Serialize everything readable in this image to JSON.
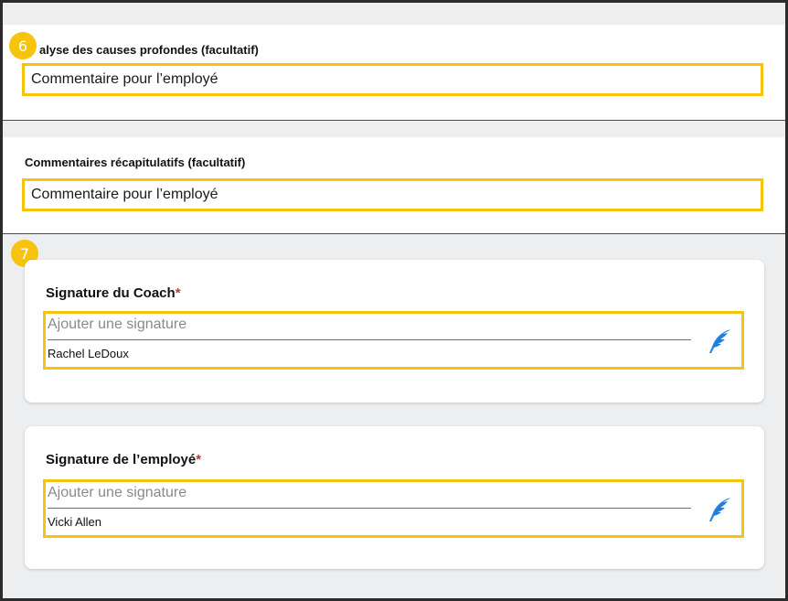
{
  "root_cause": {
    "badge": "6",
    "label": "alyse des causes profondes (facultatif)",
    "field_value": "Commentaire pour l’employé"
  },
  "summary": {
    "label": "Commentaires récapitulatifs (facultatif)",
    "field_value": "Commentaire pour l’employé"
  },
  "signatures": {
    "badge": "7",
    "coach": {
      "title": "Signature du Coach",
      "required_mark": "*",
      "placeholder": "Ajouter une signature",
      "name": "Rachel LeDoux",
      "icon": "quill-icon"
    },
    "employee": {
      "title": "Signature de l’employé",
      "required_mark": "*",
      "placeholder": "Ajouter une signature",
      "name": "Vicki Allen",
      "icon": "quill-icon"
    }
  },
  "colors": {
    "highlight": "#f6c40f",
    "quill_blue": "#1f7fe0",
    "required": "#c0392b",
    "background": "#eceef0"
  }
}
